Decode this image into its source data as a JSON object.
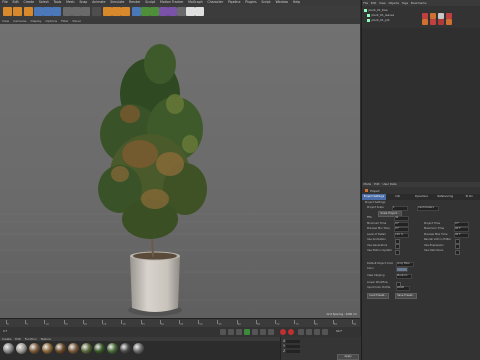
{
  "menubar": {
    "items": [
      "File",
      "Edit",
      "Create",
      "Select",
      "Tools",
      "Mesh",
      "Snap",
      "Animate",
      "Simulate",
      "Render",
      "Sculpt",
      "Motion Tracker",
      "MoGraph",
      "Character",
      "Pipeline",
      "Plugins",
      "Script",
      "Window",
      "Help"
    ]
  },
  "viewport": {
    "menu": [
      "View",
      "Cameras",
      "Display",
      "Options",
      "Filter",
      "Panel"
    ],
    "grid_spacing": "Grid Spacing : 1000 cm"
  },
  "timeline": {
    "ticks": [
      "0",
      "5",
      "10",
      "15",
      "20",
      "25",
      "30",
      "35",
      "40",
      "45",
      "50",
      "55",
      "60",
      "65",
      "70",
      "75",
      "80",
      "85",
      "90"
    ],
    "end_frame": "90 F",
    "start_frame": "0 F"
  },
  "materials": {
    "menu": [
      "Create",
      "Edit",
      "Function",
      "Texture"
    ],
    "swatch_colors": [
      "#8a8a8a",
      "#a09d98",
      "#7a5a3a",
      "#8a6a3a",
      "#6a4a2a",
      "#7a5a3a",
      "#5a6a3a",
      "#3a5a2a",
      "#4a6a3a",
      "#4a4a4a",
      "#6a6a6a"
    ]
  },
  "coords": {
    "labels": [
      "X",
      "Y",
      "Z"
    ],
    "values": [
      "0 cm",
      "0 cm",
      "0 cm"
    ],
    "mode": "Object (Rel)",
    "size_mode": "Size",
    "apply": "Apply"
  },
  "object_manager": {
    "menu": [
      "File",
      "Edit",
      "View",
      "Objects",
      "Tags",
      "Bookmarks"
    ],
    "objects": [
      "plant_01_tree",
      "plant_01_leaves",
      "plant_01_pot"
    ],
    "tag_colors": [
      "#c04040",
      "#d07030",
      "#c8c8c8",
      "#c04040",
      "#d07030",
      "#c04040",
      "#b03a3a",
      "#d07030"
    ]
  },
  "attributes": {
    "menu": [
      "Mode",
      "Edit",
      "User Data"
    ],
    "title": "Project",
    "tabs": [
      "Project Settings",
      "Info",
      "Dynamics",
      "Referencing",
      "To Do"
    ],
    "section": "Project Settings",
    "fields_left": [
      {
        "label": "Project Scale",
        "value": "1"
      },
      {
        "label": "FPS",
        "value": "30"
      },
      {
        "label": "Minimum Time",
        "value": "0 F"
      },
      {
        "label": "Preview Min Time",
        "value": "0 F"
      },
      {
        "label": "Level of Detail",
        "value": "100 %"
      },
      {
        "label": "Use Animation",
        "value": ""
      },
      {
        "label": "Use Generators",
        "value": ""
      },
      {
        "label": "Use Motion System",
        "value": ""
      }
    ],
    "fields_right": [
      {
        "label": "Project Time",
        "value": "0 F"
      },
      {
        "label": "Maximum Time",
        "value": "90 F"
      },
      {
        "label": "Preview Max Time",
        "value": "90 F"
      },
      {
        "label": "Render LOD in Editor",
        "value": ""
      },
      {
        "label": "Use Expression",
        "value": ""
      },
      {
        "label": "Use Deformers",
        "value": ""
      }
    ],
    "scale_unit": "Centimeters",
    "scale_button": "Scale Project...",
    "default_object_color_label": "Default Object Color",
    "default_object_color": "Gray Blue",
    "color_label": "Color",
    "view_clipping_label": "View Clipping",
    "view_clipping": "Medium",
    "linear_workflow_label": "Linear Workflow",
    "input_color_profile_label": "Input Color Profile",
    "input_color_profile": "sRGB",
    "load_button": "Load Preset...",
    "save_button": "Save Preset..."
  }
}
